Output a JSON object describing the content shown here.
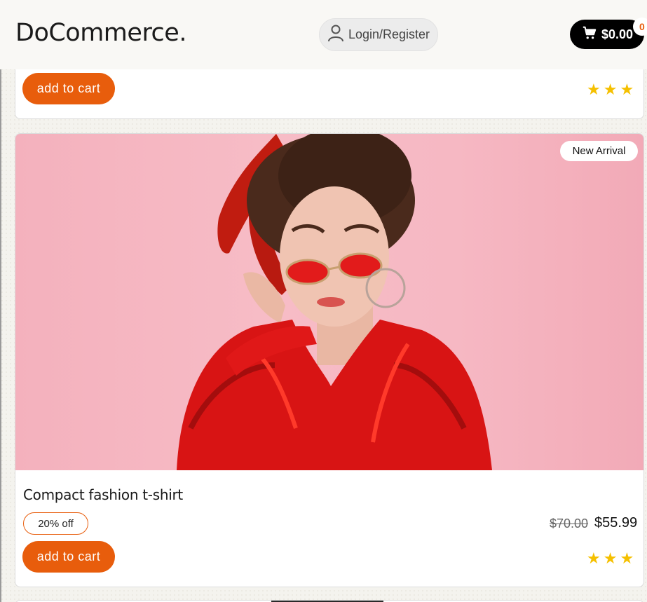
{
  "header": {
    "brand": "DoCommerce.",
    "login_label": "Login/Register",
    "cart_total": "$0.00",
    "cart_count": "0"
  },
  "products": [
    {
      "add_to_cart_label": "add to cart",
      "rating": 3
    },
    {
      "badge": "New Arrival",
      "name": "Compact fashion t-shirt",
      "discount": "20% off",
      "old_price": "$70.00",
      "price": "$55.99",
      "add_to_cart_label": "add to cart",
      "rating": 3
    }
  ],
  "colors": {
    "accent": "#e85d0c",
    "star": "#f5c000",
    "cart_button": "#000000",
    "image_background": "#f7bcc6",
    "jacket": "#d81414"
  },
  "icons": [
    "user-icon",
    "cart-icon",
    "star-icon"
  ]
}
